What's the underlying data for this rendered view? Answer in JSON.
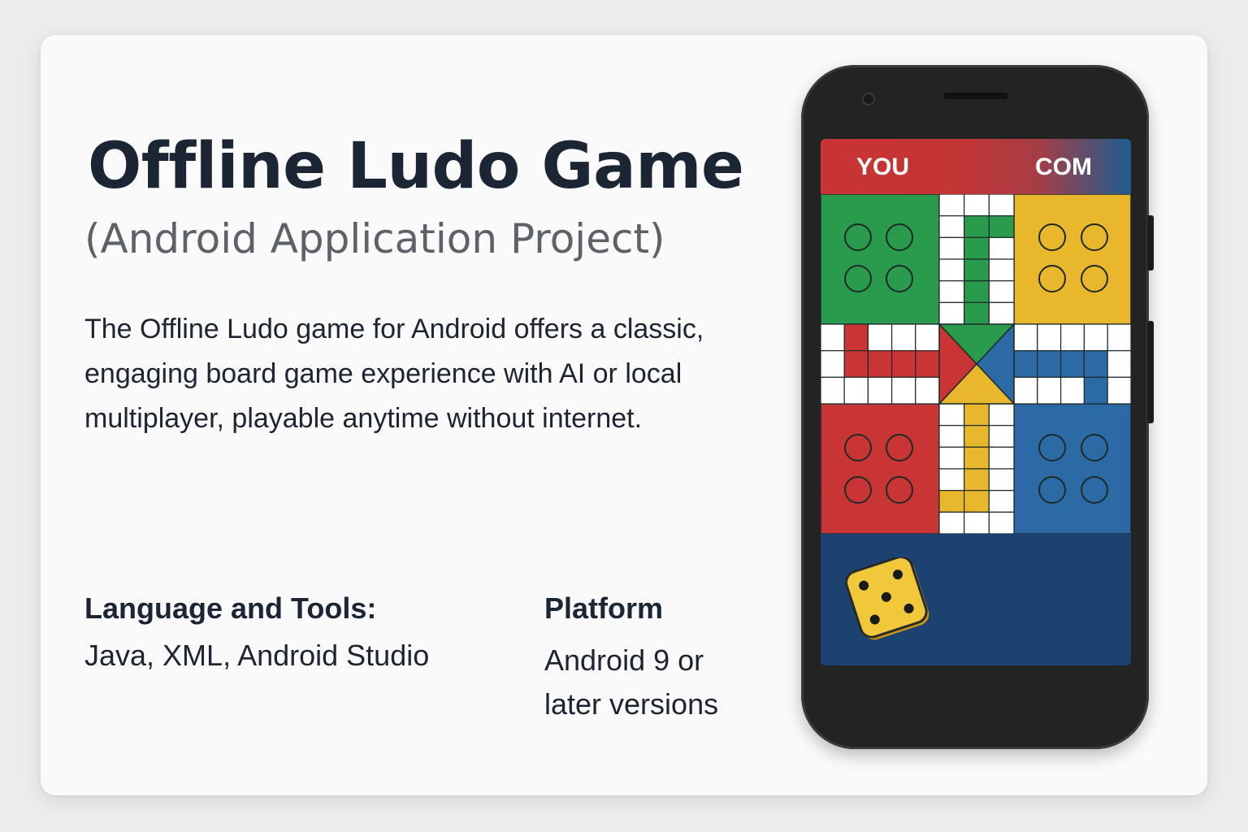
{
  "title": "Offline Ludo Game",
  "subtitle": "(Android Application Project)",
  "description": "The Offline Ludo game for Android offers a classic, engaging board game experience with AI or local multiplayer, playable anytime without internet.",
  "language_tools": {
    "heading": "Language and Tools:",
    "value": "Java, XML, Android Studio"
  },
  "platform": {
    "heading": "Platform",
    "value": "Android 9 or later versions"
  },
  "game": {
    "player_label": "YOU",
    "opponent_label": "COM",
    "dice_value": 5,
    "colors": {
      "green": "#2a9a4d",
      "yellow": "#e9b72c",
      "red": "#c93434",
      "blue": "#2c6aa5",
      "panel": "#1b4271"
    }
  }
}
